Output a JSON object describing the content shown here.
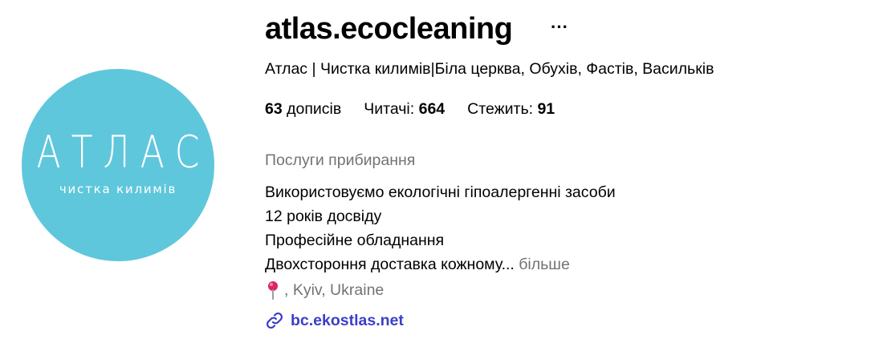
{
  "profile": {
    "username": "atlas.ecocleaning",
    "more_glyph": "···",
    "full_name": "Атлас | Чистка килимів|Біла церква, Обухів, Фастів, Васильків",
    "avatar": {
      "logo_title": "АТЛАС",
      "logo_subtitle": "чистка килимів",
      "background": "#5fc7dc"
    },
    "stats": {
      "posts_count": "63",
      "posts_label": " дописів",
      "followers_label": "Читачі: ",
      "followers_count": "664",
      "following_label": "Стежить: ",
      "following_count": "91"
    },
    "category": "Послуги прибирання",
    "bio_lines": [
      "Використовуємо екологічні гіпоалергенні засоби",
      "12 років досвіду",
      "Професійне обладнання",
      "Двохстороння доставка кожному..."
    ],
    "bio_more": "більше",
    "location": ", Kyiv, Ukraine",
    "website": "bc.ekostlas.net",
    "colors": {
      "link": "#3b3fc8",
      "secondary_text": "#737373",
      "pin": "#e0245e"
    }
  }
}
